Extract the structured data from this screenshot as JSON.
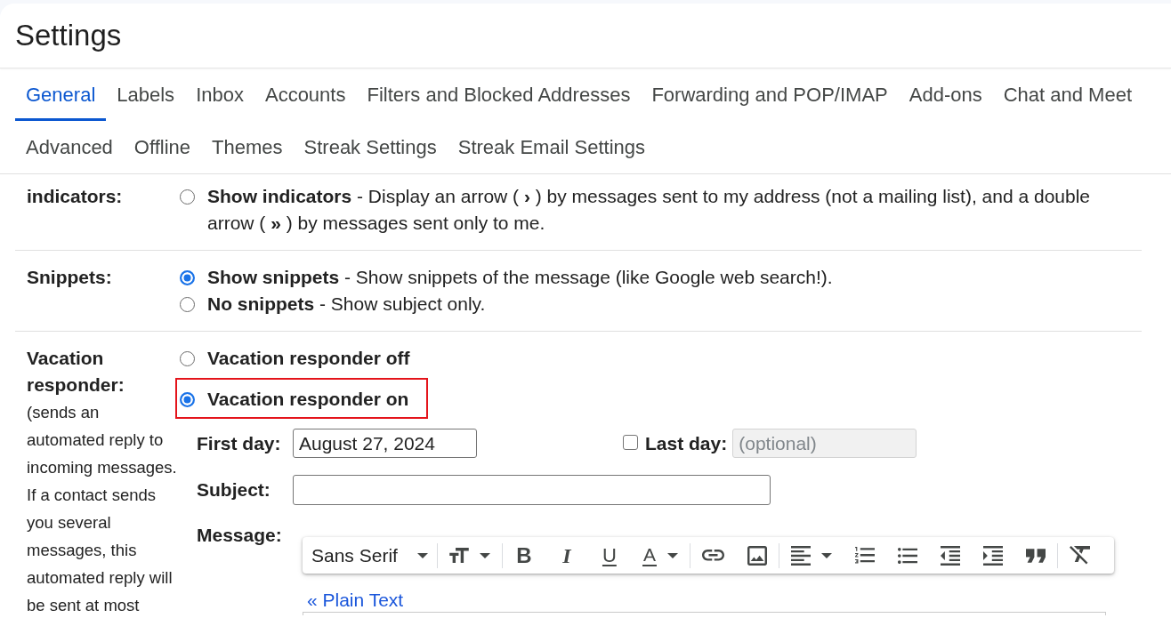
{
  "header": {
    "title": "Settings"
  },
  "tab_rows": [
    [
      {
        "label": "General",
        "selected": true
      },
      {
        "label": "Labels",
        "selected": false
      },
      {
        "label": "Inbox",
        "selected": false
      },
      {
        "label": "Accounts",
        "selected": false
      },
      {
        "label": "Filters and Blocked Addresses",
        "selected": false
      },
      {
        "label": "Forwarding and POP/IMAP",
        "selected": false
      },
      {
        "label": "Add-ons",
        "selected": false
      },
      {
        "label": "Chat and Meet",
        "selected": false
      }
    ],
    [
      {
        "label": "Advanced",
        "selected": false
      },
      {
        "label": "Offline",
        "selected": false
      },
      {
        "label": "Themes",
        "selected": false
      },
      {
        "label": "Streak Settings",
        "selected": false
      },
      {
        "label": "Streak Email Settings",
        "selected": false
      }
    ]
  ],
  "settings": [
    {
      "label": "indicators:",
      "options": [
        {
          "text": "**Show indicators** - Display an arrow ( **›** ) by messages sent to my address (not a mailing list), and a double arrow ( **»** ) by messages sent only to me.",
          "selected": false
        }
      ]
    },
    {
      "label": "Snippets:",
      "options": [
        {
          "text": "**Show snippets** - Show snippets of the message (like Google web search!).",
          "selected": true
        },
        {
          "text": "**No snippets** - Show subject only.",
          "selected": false
        }
      ]
    }
  ],
  "vacation_responder": {
    "label": "Vacation responder:",
    "note": "(sends an automated reply to incoming messages. If a contact sends you several messages, this automated reply will be sent at most",
    "options": [
      {
        "text": "Vacation responder off",
        "selected": false,
        "highlighted": false
      },
      {
        "text": "Vacation responder on",
        "selected": true,
        "highlighted": true
      }
    ],
    "first_day": {
      "label": "First day:",
      "value": "August 27, 2024"
    },
    "last_day": {
      "label": "Last day:",
      "checked": false,
      "placeholder": "(optional)",
      "disabled": true
    },
    "subject": {
      "label": "Subject:"
    },
    "message": {
      "label": "Message:",
      "toolbar": [
        [
          {
            "kind": "font",
            "label": "Sans Serif",
            "dropdown": true
          }
        ],
        [
          {
            "kind": "size",
            "dropdown": true
          }
        ],
        [
          {
            "kind": "bold",
            "label": "B",
            "dropdown": false
          },
          {
            "kind": "italic",
            "label": "I",
            "dropdown": false
          },
          {
            "kind": "underline",
            "label": "U",
            "dropdown": false
          },
          {
            "kind": "text-color",
            "label": "A",
            "dropdown": true
          }
        ],
        [
          {
            "kind": "link",
            "dropdown": false
          },
          {
            "kind": "image",
            "dropdown": false
          }
        ],
        [
          {
            "kind": "align",
            "dropdown": true
          },
          {
            "kind": "numbered-list",
            "dropdown": false
          },
          {
            "kind": "bulleted-list",
            "dropdown": false
          },
          {
            "kind": "indent-less",
            "dropdown": false
          },
          {
            "kind": "indent-more",
            "dropdown": false
          },
          {
            "kind": "quote",
            "dropdown": false
          }
        ],
        [
          {
            "kind": "remove-formatting",
            "dropdown": false
          }
        ]
      ],
      "plain_text_link": "« Plain Text"
    }
  }
}
